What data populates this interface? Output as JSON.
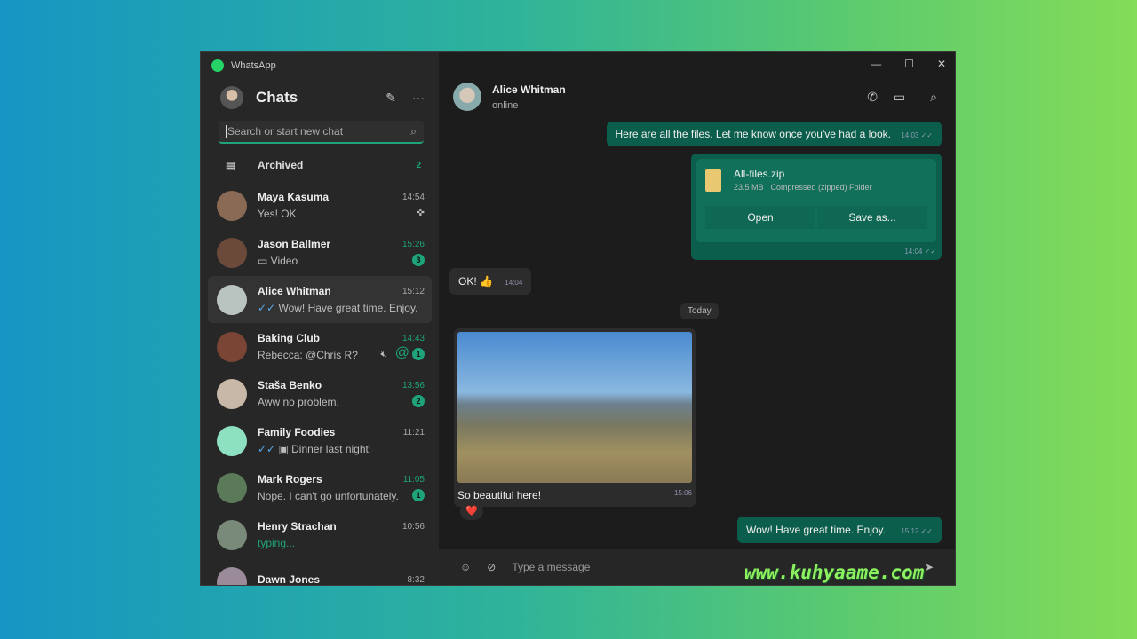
{
  "app": {
    "title": "WhatsApp"
  },
  "sidebar": {
    "title": "Chats",
    "search_placeholder": "Search or start new chat",
    "archived": {
      "label": "Archived",
      "count": "2"
    },
    "chats": [
      {
        "name": "Maya Kasuma",
        "time": "14:54",
        "preview": "Yes! OK",
        "pinned": true,
        "avatar": "#8a6a55"
      },
      {
        "name": "Jason Ballmer",
        "time": "15:26",
        "preview": "Video",
        "unread": "3",
        "video": true,
        "avatar": "#6b4a3a"
      },
      {
        "name": "Alice Whitman",
        "time": "15:12",
        "preview": "Wow! Have great time. Enjoy.",
        "read": true,
        "selected": true,
        "avatar": "#b9c4c0"
      },
      {
        "name": "Baking Club",
        "time": "14:43",
        "preview": "Rebecca: @Chris R?",
        "unread": "1",
        "muted": true,
        "mention": "@",
        "avatar": "#7a4535"
      },
      {
        "name": "Staša Benko",
        "time": "13:56",
        "preview": "Aww no problem.",
        "unread": "2",
        "avatar": "#c8b8a8"
      },
      {
        "name": "Family Foodies",
        "time": "11:21",
        "preview": "Dinner last night!",
        "read": true,
        "photo": true,
        "avatar": "#8de0c0"
      },
      {
        "name": "Mark Rogers",
        "time": "11:05",
        "preview": "Nope. I can't go unfortunately.",
        "unread": "1",
        "avatar": "#5a7a5a"
      },
      {
        "name": "Henry Strachan",
        "time": "10:56",
        "preview": "typing...",
        "typing": true,
        "avatar": "#7a8a7a"
      },
      {
        "name": "Dawn Jones",
        "time": "8:32",
        "preview": "",
        "avatar": "#9a8a9a"
      }
    ]
  },
  "chat": {
    "name": "Alice Whitman",
    "status": "online",
    "messages": {
      "m1": {
        "text": "Here are all the files. Let me know once you've had a look.",
        "time": "14:03"
      },
      "file": {
        "name": "All-files.zip",
        "info": "23.5 MB · Compressed (zipped) Folder",
        "open": "Open",
        "save": "Save as...",
        "time": "14:04"
      },
      "m3": {
        "text": "OK! 👍",
        "time": "14:04"
      },
      "date": "Today",
      "photo": {
        "caption": "So beautiful here!",
        "time": "15:06",
        "reaction": "❤️"
      },
      "m5": {
        "text": "Wow! Have great time. Enjoy.",
        "time": "15:12"
      }
    },
    "composer_placeholder": "Type a message"
  },
  "watermark": "www.kuhyaame.com",
  "colors": {
    "accent": "#1fa37a",
    "outgoing": "#0b5e4b"
  }
}
